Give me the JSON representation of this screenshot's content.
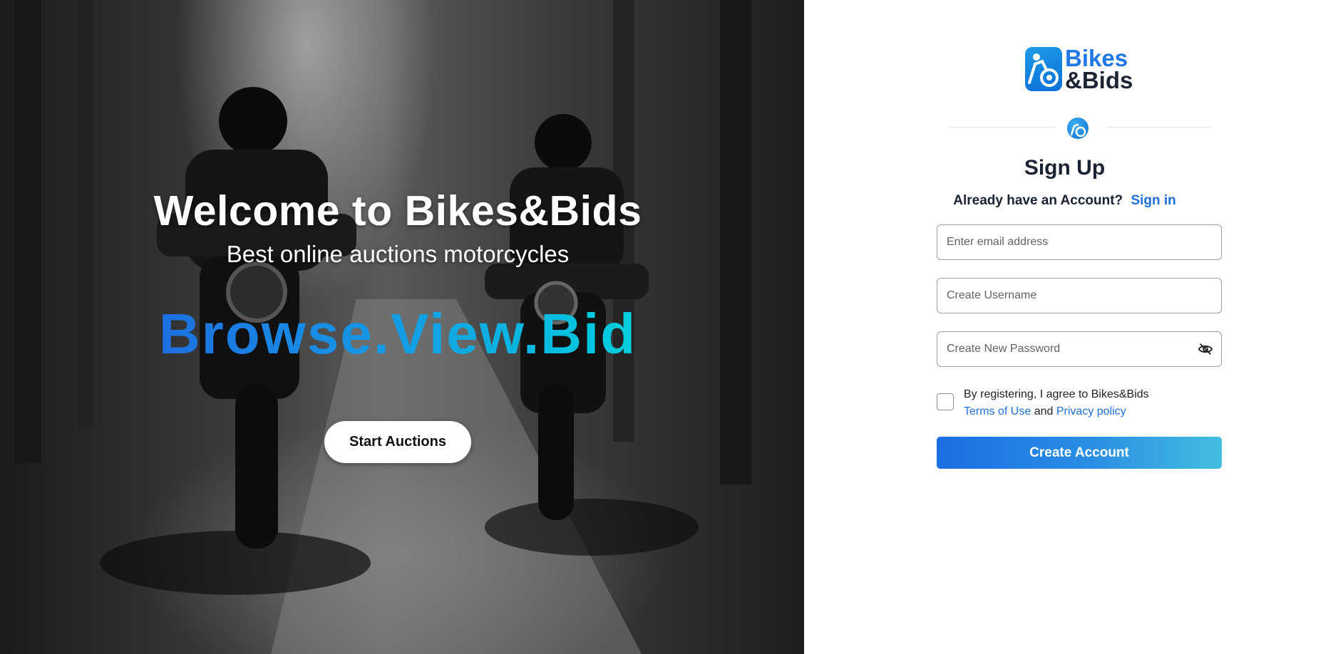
{
  "hero": {
    "title": "Welcome to Bikes&Bids",
    "subtitle": "Best online auctions motorcycles",
    "tagline": "Browse.View.Bid",
    "cta_label": "Start Auctions"
  },
  "brand": {
    "line1": "Bikes",
    "line2": "&Bids",
    "logo_icon": "motorcycle-logo-icon"
  },
  "signup": {
    "title": "Sign Up",
    "already_text": "Already have an Account?",
    "signin_label": "Sign in",
    "email_placeholder": "Enter email address",
    "email_value": "",
    "username_placeholder": "Create Username",
    "username_value": "",
    "password_placeholder": "Create New Password",
    "password_value": "",
    "password_toggle_icon": "eye-slash-icon",
    "agree_text": "By registering, I agree to Bikes&Bids",
    "terms_label": "Terms of Use",
    "and_text": "and",
    "privacy_label": "Privacy policy",
    "agree_checked": false,
    "submit_label": "Create Account"
  },
  "colors": {
    "accent": "#1f6fd8",
    "gradient_start": "#1b6fe3",
    "gradient_end": "#45bde0",
    "dark_text": "#1b2333"
  }
}
